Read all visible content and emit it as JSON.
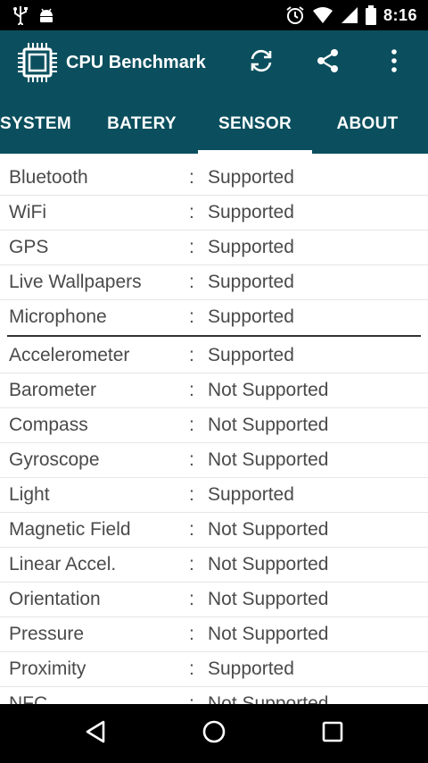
{
  "status_bar": {
    "time": "8:16"
  },
  "app_bar": {
    "title": "CPU Benchmark"
  },
  "tabs": [
    {
      "label": "SYSTEM",
      "selected": false
    },
    {
      "label": "BATERY",
      "selected": false
    },
    {
      "label": "SENSOR",
      "selected": true
    },
    {
      "label": "ABOUT",
      "selected": false
    }
  ],
  "separator": ":",
  "features": [
    {
      "name": "Bluetooth",
      "value": "Supported"
    },
    {
      "name": "WiFi",
      "value": "Supported"
    },
    {
      "name": "GPS",
      "value": "Supported"
    },
    {
      "name": "Live Wallpapers",
      "value": "Supported"
    },
    {
      "name": "Microphone",
      "value": "Supported"
    }
  ],
  "sensors": [
    {
      "name": "Accelerometer",
      "value": "Supported"
    },
    {
      "name": "Barometer",
      "value": "Not Supported"
    },
    {
      "name": "Compass",
      "value": "Not Supported"
    },
    {
      "name": "Gyroscope",
      "value": "Not Supported"
    },
    {
      "name": "Light",
      "value": "Supported"
    },
    {
      "name": "Magnetic Field",
      "value": "Not Supported"
    },
    {
      "name": "Linear Accel.",
      "value": "Not Supported"
    },
    {
      "name": "Orientation",
      "value": "Not Supported"
    },
    {
      "name": "Pressure",
      "value": "Not Supported"
    },
    {
      "name": "Proximity",
      "value": "Supported"
    },
    {
      "name": "NFC",
      "value": "Not Supported"
    }
  ],
  "colors": {
    "primary": "#0b4f5e",
    "text": "#4a4a4a",
    "status_bar": "#000000"
  }
}
